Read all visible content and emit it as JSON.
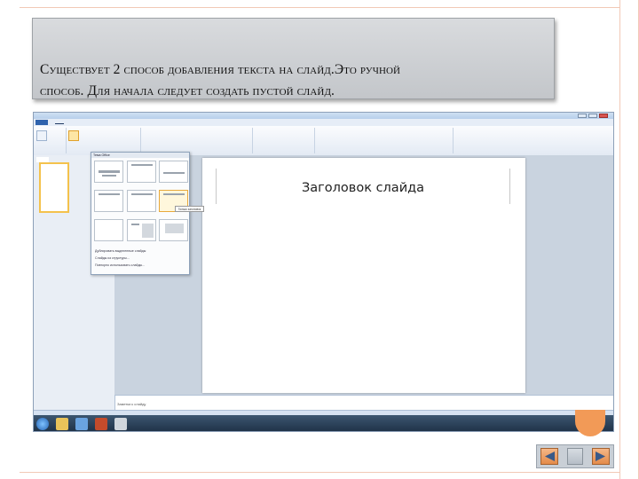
{
  "slide": {
    "heading_line1": "Существует 2 способ добавления текста на слайд.Это ручной",
    "heading_line2": "способ. Для начала следует создать пустой слайд."
  },
  "screenshot": {
    "slide_title_placeholder": "Заголовок слайда",
    "notes_placeholder": "Заметки к слайду",
    "layout_gallery_header": "Тема Office",
    "selected_layout_tooltip": "Только заголовок",
    "layout_menu_items": [
      "Дублировать выделенные слайды",
      "Слайды из структуры...",
      "Повторно использовать слайды..."
    ]
  },
  "colors": {
    "frame_line": "#f2c9b6",
    "accent_orange": "#f29a57",
    "ribbon_blue": "#2f63ad"
  }
}
